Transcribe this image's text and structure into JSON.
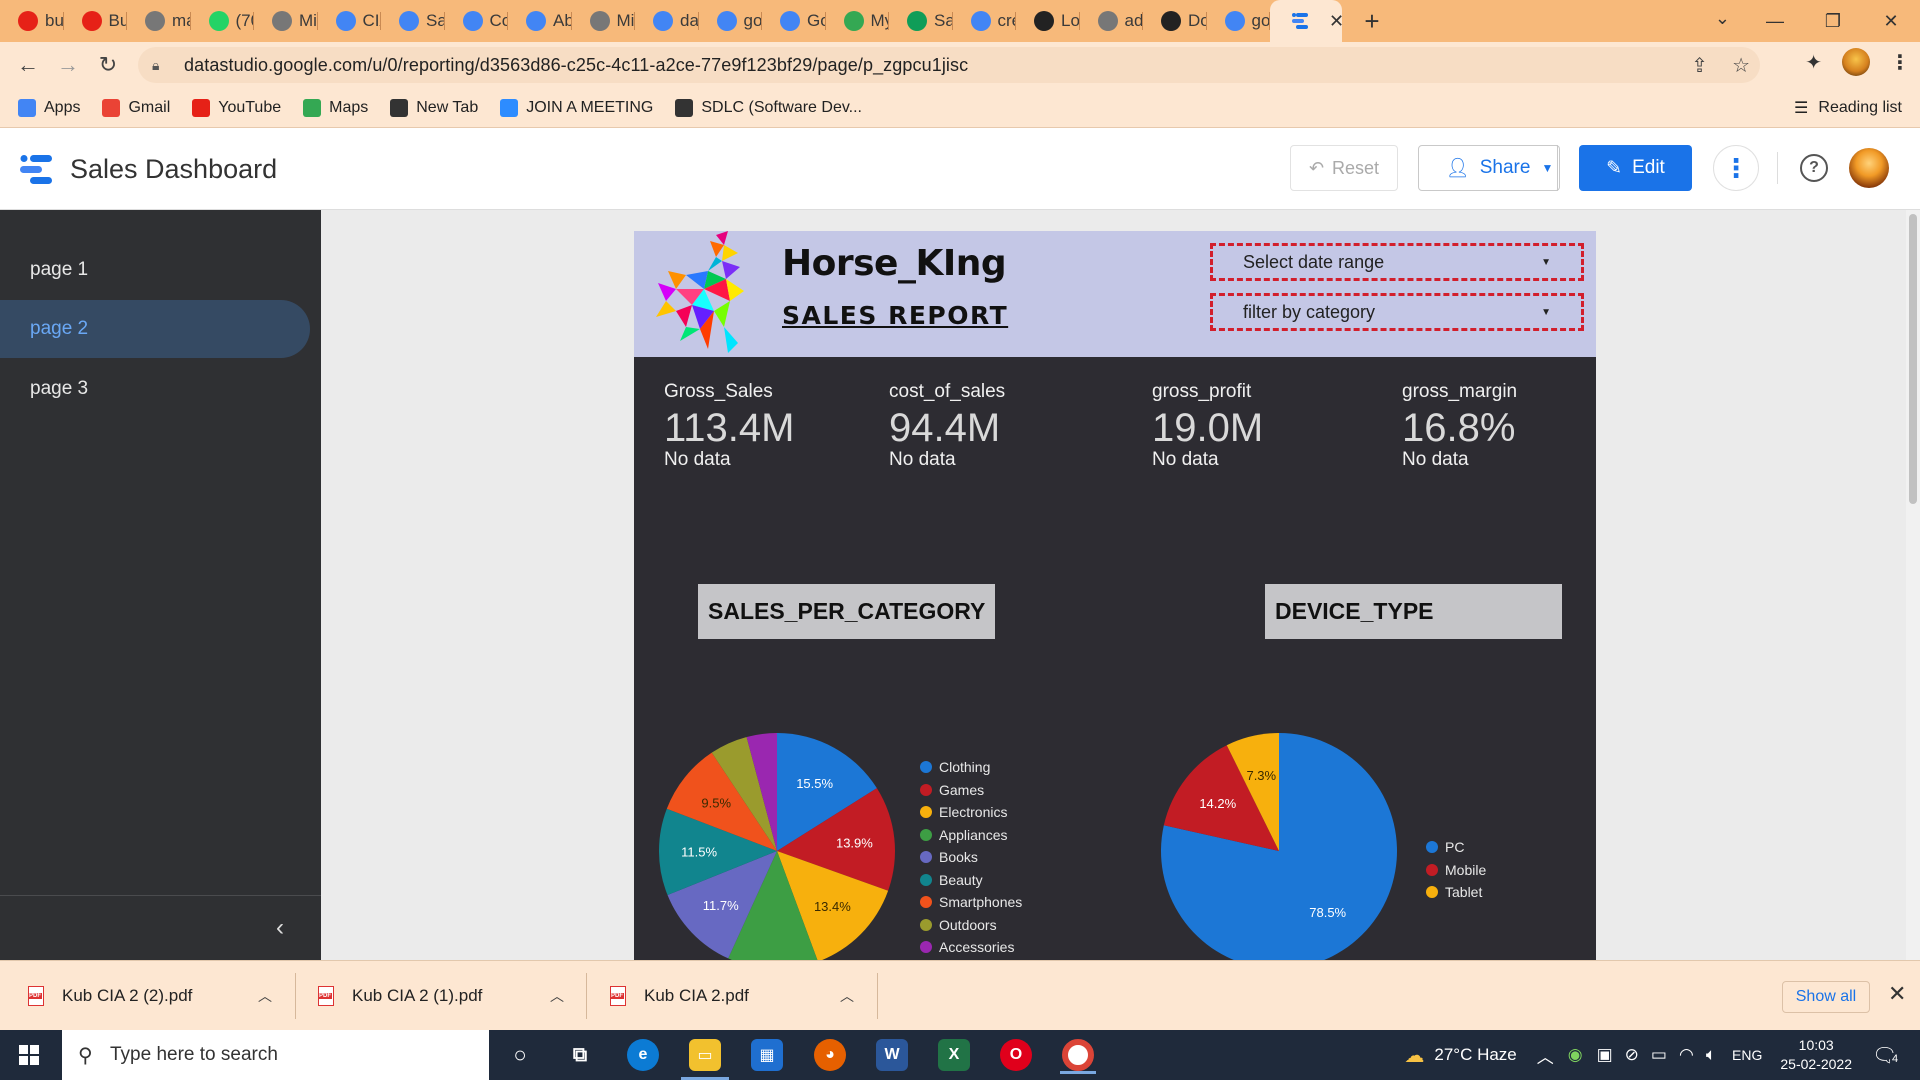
{
  "browser": {
    "tabs": [
      {
        "label": "bus",
        "icon": "youtube-icon",
        "color": "#e62117"
      },
      {
        "label": "Bus",
        "icon": "youtube-icon",
        "color": "#e62117"
      },
      {
        "label": "ma",
        "icon": "globe-icon",
        "color": "#777777"
      },
      {
        "label": "(70)",
        "icon": "whatsapp-icon",
        "color": "#25d366"
      },
      {
        "label": "Mic",
        "icon": "globe-icon",
        "color": "#777777"
      },
      {
        "label": "CIA",
        "icon": "datastudio-icon",
        "color": "#4285f4"
      },
      {
        "label": "Sale",
        "icon": "datastudio-icon",
        "color": "#4285f4"
      },
      {
        "label": "Cop",
        "icon": "datastudio-icon",
        "color": "#4285f4"
      },
      {
        "label": "Abo",
        "icon": "google-icon",
        "color": "#4285f4"
      },
      {
        "label": "Mic",
        "icon": "globe-icon",
        "color": "#777777"
      },
      {
        "label": "data",
        "icon": "google-icon",
        "color": "#4285f4"
      },
      {
        "label": "goo",
        "icon": "google-icon",
        "color": "#4285f4"
      },
      {
        "label": "Goo",
        "icon": "google-icon",
        "color": "#4285f4"
      },
      {
        "label": "My",
        "icon": "drive-icon",
        "color": "#34a853"
      },
      {
        "label": "Sale",
        "icon": "sheets-icon",
        "color": "#0f9d58"
      },
      {
        "label": "crea",
        "icon": "google-icon",
        "color": "#4285f4"
      },
      {
        "label": "Log",
        "icon": "pf-icon",
        "color": "#222222"
      },
      {
        "label": "adc",
        "icon": "globe-icon",
        "color": "#777777"
      },
      {
        "label": "Dov",
        "icon": "pf-icon",
        "color": "#222222"
      },
      {
        "label": "goo",
        "icon": "google-icon",
        "color": "#4285f4"
      }
    ],
    "url": "datastudio.google.com/u/0/reporting/d3563d86-c25c-4c11-a2ce-77e9f123bf29/page/p_zgpcu1jisc",
    "bookmarks": [
      {
        "label": "Apps",
        "icon": "apps-grid-icon",
        "color": "#4285f4"
      },
      {
        "label": "Gmail",
        "icon": "gmail-icon",
        "color": "#ea4335"
      },
      {
        "label": "YouTube",
        "icon": "youtube-icon",
        "color": "#e62117"
      },
      {
        "label": "Maps",
        "icon": "maps-pin-icon",
        "color": "#34a853"
      },
      {
        "label": "New Tab",
        "icon": "globe-icon",
        "color": "#333333"
      },
      {
        "label": "JOIN A MEETING",
        "icon": "zoom-icon",
        "color": "#2d8cff"
      },
      {
        "label": "SDLC (Software Dev...",
        "icon": "globe-icon",
        "color": "#333333"
      }
    ],
    "reading_list": "Reading list"
  },
  "app": {
    "title": "Sales Dashboard",
    "reset_label": "Reset",
    "share_label": "Share",
    "edit_label": "Edit",
    "accent": "#1a73e8"
  },
  "sidebar": {
    "pages": [
      {
        "label": "page 1",
        "active": false
      },
      {
        "label": "page 2",
        "active": true
      },
      {
        "label": "page 3",
        "active": false
      }
    ]
  },
  "report": {
    "brand_name": "Horse_KIng",
    "brand_subtitle": "SALES REPORT",
    "filters": {
      "date_range": "Select date range",
      "category": "filter by category"
    },
    "scorecards": [
      {
        "label": "Gross_Sales",
        "value": "113.4M",
        "comparison": "No data"
      },
      {
        "label": "cost_of_sales",
        "value": "94.4M",
        "comparison": "No data"
      },
      {
        "label": "gross_profit",
        "value": "19.0M",
        "comparison": "No data"
      },
      {
        "label": "gross_margin",
        "value": "16.8%",
        "comparison": "No data"
      }
    ]
  },
  "chart_data": [
    {
      "type": "pie",
      "title": "SALES_PER_CATEGORY",
      "categories": [
        "Clothing",
        "Games",
        "Electronics",
        "Appliances",
        "Books",
        "Beauty",
        "Smartphones",
        "Outdoors",
        "Accessories"
      ],
      "values": [
        15.5,
        13.9,
        13.4,
        12.0,
        11.7,
        11.5,
        9.5,
        5.0,
        4.0
      ],
      "value_labels": [
        "15.5%",
        "13.9%",
        "13.4%",
        "",
        "11.7%",
        "11.5%",
        "9.5%",
        "",
        ""
      ],
      "colors": [
        "#1c77d6",
        "#c21c24",
        "#f7b00d",
        "#3d9e44",
        "#6769c2",
        "#11858e",
        "#f0521c",
        "#9a9b2d",
        "#9a27b0"
      ],
      "legend_position": "right"
    },
    {
      "type": "pie",
      "title": "DEVICE_TYPE",
      "categories": [
        "PC",
        "Mobile",
        "Tablet"
      ],
      "values": [
        78.5,
        14.2,
        7.3
      ],
      "value_labels": [
        "78.5%",
        "14.2%",
        "7.3%"
      ],
      "colors": [
        "#1c77d6",
        "#c21c24",
        "#f7b00d"
      ],
      "legend_position": "right"
    }
  ],
  "downloads": {
    "items": [
      "Kub CIA 2 (2).pdf",
      "Kub CIA 2 (1).pdf",
      "Kub CIA 2.pdf"
    ],
    "show_all": "Show all"
  },
  "taskbar": {
    "search_placeholder": "Type here to search",
    "weather": "27°C  Haze",
    "language": "ENG",
    "time": "10:03",
    "date": "25-02-2022",
    "notifications": "4"
  }
}
